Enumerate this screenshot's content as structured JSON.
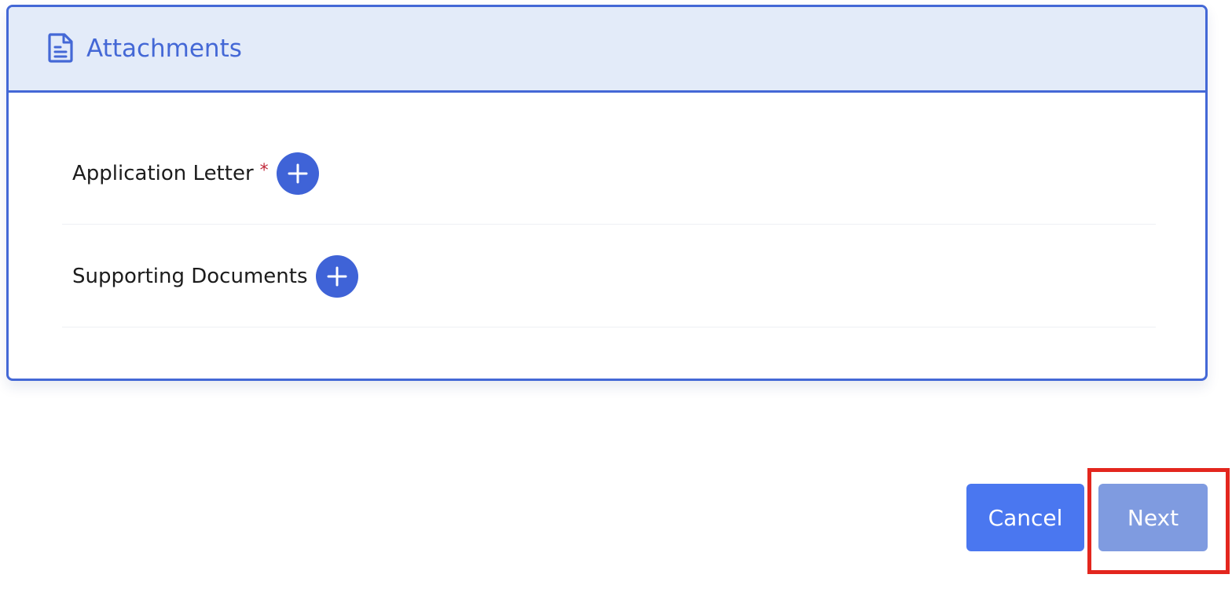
{
  "section": {
    "title": "Attachments",
    "icon": "document-icon",
    "accent_color": "#4468d6",
    "header_bg": "#e3ebf9"
  },
  "attachments": [
    {
      "label": "Application Letter",
      "required": true,
      "required_mark": "*",
      "action_icon": "plus-circle-icon"
    },
    {
      "label": "Supporting Documents",
      "required": false,
      "action_icon": "plus-circle-icon"
    }
  ],
  "footer": {
    "cancel_label": "Cancel",
    "next_label": "Next",
    "cancel_color": "#4a77f0",
    "next_color": "#7f9be0",
    "highlighted_button": "Next",
    "highlight_color": "#e3261e"
  }
}
